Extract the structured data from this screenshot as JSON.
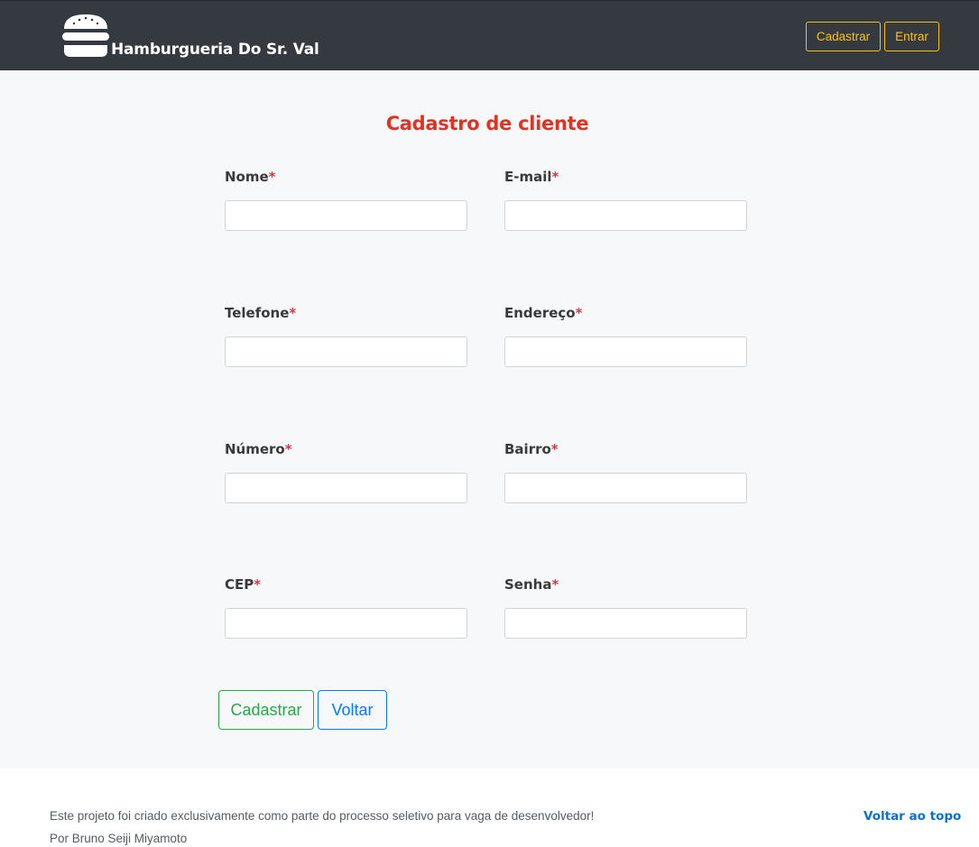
{
  "navbar": {
    "brand_name": "Hamburgueria Do Sr. Val",
    "brand_icon": "burger-icon",
    "cadastrar_label": "Cadastrar",
    "entrar_label": "Entrar",
    "background_color": "#343a40",
    "accent_color": "#ffc107"
  },
  "form": {
    "title": "Cadastro de cliente",
    "required_marker": "*",
    "fields": [
      {
        "label": "Nome",
        "value": ""
      },
      {
        "label": "E-mail",
        "value": ""
      },
      {
        "label": "Telefone",
        "value": ""
      },
      {
        "label": "Endereço",
        "value": ""
      },
      {
        "label": "Número",
        "value": ""
      },
      {
        "label": "Bairro",
        "value": ""
      },
      {
        "label": "CEP",
        "value": ""
      },
      {
        "label": "Senha",
        "value": ""
      }
    ],
    "submit_label": "Cadastrar",
    "back_label": "Voltar",
    "title_color": "#e03323"
  },
  "footer": {
    "line1": "Este projeto foi criado exclusivamente como parte do processo seletivo para vaga de desenvolvedor!",
    "line2": "Por Bruno Seiji Miyamoto",
    "back_to_top_label": "Voltar ao topo"
  }
}
